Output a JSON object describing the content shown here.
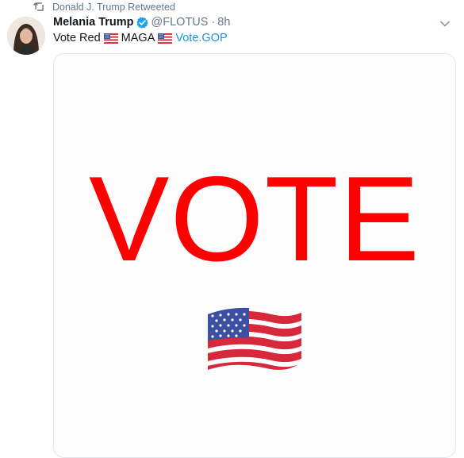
{
  "retweet": {
    "label": "Donald J. Trump Retweeted",
    "icon": "retweet-icon"
  },
  "author": {
    "name": "Melania Trump",
    "handle": "@FLOTUS",
    "separator": "·",
    "time": "8h",
    "verified": true
  },
  "tweet": {
    "text_1": "Vote Red",
    "text_2": "MAGA",
    "link": "Vote.GOP"
  },
  "media": {
    "headline": "VOTE",
    "emoji": "us-flag-emoji"
  },
  "colors": {
    "vote_red": "#ff0000",
    "link_blue": "#1b95e0",
    "muted": "#657786",
    "verified_blue": "#1da1f2"
  }
}
